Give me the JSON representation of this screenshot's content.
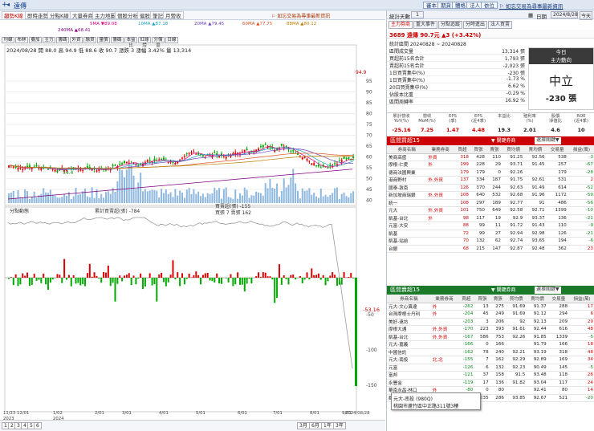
{
  "app": {
    "title": "遠傳",
    "menu": [
      "審本",
      "期貨",
      "體格",
      "法人",
      "依位"
    ],
    "date_label": "日期",
    "date_value": "2024/8/28",
    "today_btn": "今天",
    "alert": "⚐ 如忘交易為尋事最新資訊"
  },
  "tabs": [
    "趨勢K線",
    "即時走勢",
    "分點K線",
    "大量券商",
    "主力地圖",
    "個股分析",
    "偏股",
    "筆記",
    "月營收"
  ],
  "ma_legend": [
    "5MA ▼89.08",
    "10MA ▲87.18",
    "20MA ▲79.45",
    "60MA ▲77.75",
    "88MA ▲80.12",
    "240MA ▲68.41"
  ],
  "indicator_tabs": [
    "均線",
    "布林",
    "疊加",
    "主力",
    "籌碼",
    "外資",
    "融資",
    "量價",
    "籌碼",
    "本益比",
    "紅綠燈",
    "分價量",
    "日線"
  ],
  "ohlc": "2024/08/28 開 88.0 高 94.9 低 88.6 收 90.7 漲跌 3 漲幅 3.42% 量 13,314",
  "price_axis": [
    "95",
    "90",
    "85",
    "80",
    "75",
    "70",
    "65",
    "60",
    "55",
    "50",
    "45",
    "40"
  ],
  "chart_labels": {
    "high": "94.9",
    "low": "54.4",
    "sub_legend": "累計買賣超(張) -784",
    "sub_legend2": "買賣超(張) -155",
    "sub_legend3": "買張 7 賣張 162",
    "sub_select": "分點動態",
    "sub_last": "-53.16",
    "sub_axis": [
      "-50",
      "-100",
      "-150"
    ]
  },
  "date_axis": [
    "11/23 12/01\n2023",
    "1/02\n2024",
    "2/01",
    "3/01",
    "4/01",
    "5/01",
    "6/01",
    "7/01",
    "8/01",
    "9/01",
    "2024/08/28"
  ],
  "period_btns": [
    "1",
    "2",
    "3",
    "4",
    "5",
    "6",
    "3月",
    "6月",
    "1年",
    "3年"
  ],
  "right": {
    "summary_title": "統計天數",
    "summary_value": "1",
    "tabs2": [
      "主力券商",
      "重大事件",
      "分點追蹤",
      "分時進出",
      "法人買賣"
    ],
    "stock_line": "3689 遠傳 90.7元 ▲3 (+3.42%)",
    "period": "統計區間 20240828 ~ 20240828",
    "stats": [
      [
        "區間成交量",
        "13,314 張"
      ],
      [
        "買超前15名合計",
        "1,793 張"
      ],
      [
        "賣超前15名合計",
        "-2,023 張"
      ],
      [
        "1日買賣集中(%)",
        "-230 張"
      ],
      [
        "1日買賣集中(%)",
        "-1.73 %"
      ],
      [
        "20日買賣集中(%)",
        "6.62 %"
      ],
      [
        "佔股本比重",
        "-0.29 %"
      ],
      [
        "區間周轉率",
        "16.92 %"
      ]
    ],
    "today_box": {
      "t1": "今日",
      "t2": "主力動向",
      "big": "中立",
      "val": "-230 張"
    },
    "fund_head": [
      "累計營收\nYoY(%)",
      "營收\nMoM(%)",
      "EPS\n(季)",
      "EPS\n(近4季)",
      "本益比",
      "殖利率\n(%)",
      "股價\n淨值比",
      "ROE\n(近4季)"
    ],
    "fund_vals": [
      "-25.16",
      "7.25",
      "1.47",
      "4.48",
      "19.3",
      "2.01",
      "4.6",
      "10"
    ],
    "buy_title": "區間買超15",
    "sell_title": "區間賣超15",
    "sort_label": "▼ 關鍵券商",
    "sort_opt": "選擇關鍵▼",
    "cols": [
      "券商名稱",
      "業務券商",
      "買超",
      "買張",
      "賣張",
      "買均價",
      "賣均價",
      "交易量",
      "損益(萬)"
    ],
    "buy_rows": [
      [
        "美商高盛",
        "外資",
        "318",
        "428",
        "110",
        "91.25",
        "92.56",
        "538",
        "-3"
      ],
      [
        "摩根-仁愛",
        "外",
        "199",
        "228",
        "29",
        "93.71",
        "91.45",
        "257",
        "-67"
      ],
      [
        "德商法國興業",
        "",
        "179",
        "179",
        "0",
        "92.26",
        "",
        "179",
        "-28"
      ],
      [
        "港商野村",
        "外,外資",
        "137",
        "334",
        "187",
        "91.75",
        "92.61",
        "531",
        "2"
      ],
      [
        "國泰-敦南",
        "",
        "126",
        "370",
        "244",
        "92.63",
        "91.49",
        "614",
        "-52"
      ],
      [
        "新加坡商瑞銀",
        "外,外資",
        "108",
        "640",
        "532",
        "92.68",
        "91.96",
        "1172",
        "-59"
      ],
      [
        "統一",
        "",
        "108",
        "297",
        "189",
        "92.77",
        "91",
        "486",
        "-56"
      ],
      [
        "元大",
        "外,外資",
        "101",
        "750",
        "649",
        "92.58",
        "92.71",
        "1399",
        "-10"
      ],
      [
        "凱基-台北",
        "外",
        "98",
        "117",
        "19",
        "92.9",
        "93.37",
        "136",
        "-21"
      ],
      [
        "元富-大安",
        "",
        "88",
        "99",
        "11",
        "91.72",
        "91.43",
        "110",
        "-9"
      ],
      [
        "凱基",
        "",
        "72",
        "99",
        "27",
        "92.94",
        "92.98",
        "126",
        "-21"
      ],
      [
        "凱基-站前",
        "",
        "70",
        "132",
        "62",
        "92.74",
        "93.65",
        "194",
        "-6"
      ],
      [
        "台銀",
        "",
        "68",
        "215",
        "147",
        "92.87",
        "92.48",
        "362",
        "23"
      ]
    ],
    "sell_rows": [
      [
        "元大-文心異達",
        "外",
        "-262",
        "13",
        "275",
        "91.69",
        "91.37",
        "288",
        "17"
      ],
      [
        "台灣摩根士丹利",
        "外",
        "-204",
        "45",
        "249",
        "91.69",
        "91.12",
        "294",
        "6"
      ],
      [
        "美好-遠坊",
        "",
        "-203",
        "3",
        "206",
        "92",
        "92.13",
        "209",
        "29"
      ],
      [
        "摩根大通",
        "外,外資",
        "-170",
        "223",
        "393",
        "91.61",
        "92.44",
        "616",
        "48"
      ],
      [
        "凱基-台北",
        "外,外資",
        "-167",
        "586",
        "753",
        "92.26",
        "91.85",
        "1339",
        "-5"
      ],
      [
        "元大-嘉義",
        "",
        "-166",
        "0",
        "166",
        "",
        "91.79",
        "166",
        "18"
      ],
      [
        "中國信託",
        "",
        "-162",
        "78",
        "240",
        "92.21",
        "93.19",
        "318",
        "48"
      ],
      [
        "元大-南投",
        "北,北",
        "-155",
        "7",
        "162",
        "92.29",
        "92.89",
        "169",
        "34"
      ],
      [
        "元富",
        "",
        "-126",
        "6",
        "132",
        "92.23",
        "90.49",
        "145",
        "-5"
      ],
      [
        "富邦",
        "",
        "-121",
        "37",
        "158",
        "91.5",
        "93.48",
        "118",
        "26"
      ],
      [
        "永豐金",
        "",
        "-119",
        "17",
        "136",
        "91.82",
        "93.04",
        "117",
        "24"
      ],
      [
        "華南永昌-林口",
        "外",
        "-80",
        "0",
        "80",
        "",
        "92.41",
        "80",
        "14"
      ],
      [
        "群益金鼎-台北",
        "外",
        "-51",
        "235",
        "286",
        "93.85",
        "92.67",
        "521",
        "-20"
      ]
    ],
    "tooltip": [
      "元大-南投 (980Q)",
      "桃園市蘆竹區中正路311號3樓"
    ]
  }
}
